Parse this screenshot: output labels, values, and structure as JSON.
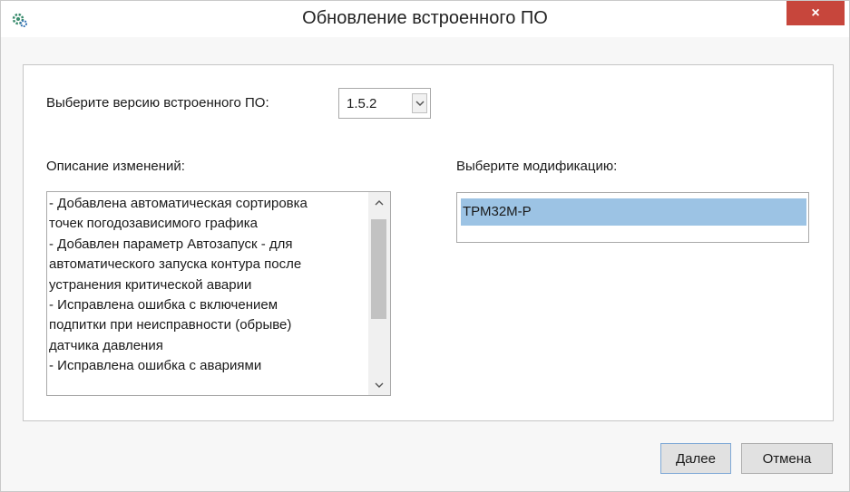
{
  "window": {
    "title": "Обновление встроенного ПО",
    "close_label": "×"
  },
  "version": {
    "label": "Выберите версию встроенного ПО:",
    "selected": "1.5.2"
  },
  "changes": {
    "label": "Описание изменений:",
    "lines": [
      "- Добавлена автоматическая сортировка",
      "точек погодозависимого графика",
      "- Добавлен параметр Автозапуск - для",
      "автоматического запуска контура после",
      "устранения критической аварии",
      "- Исправлена ошибка с включением",
      "подпитки при неисправности (обрыве)",
      "датчика давления",
      "- Исправлена ошибка с авариями"
    ]
  },
  "modification": {
    "label": "Выберите модификацию:",
    "items": [
      "ТРМ32М-Р"
    ]
  },
  "buttons": {
    "next": "Далее",
    "cancel": "Отмена"
  },
  "colors": {
    "close_button": "#c7463c",
    "selection": "#9cc3e4"
  },
  "icons": {
    "app": "gear-icon",
    "close": "close-icon",
    "dropdown": "chevron-down-icon",
    "scroll_up": "chevron-up-icon",
    "scroll_down": "chevron-down-icon"
  }
}
